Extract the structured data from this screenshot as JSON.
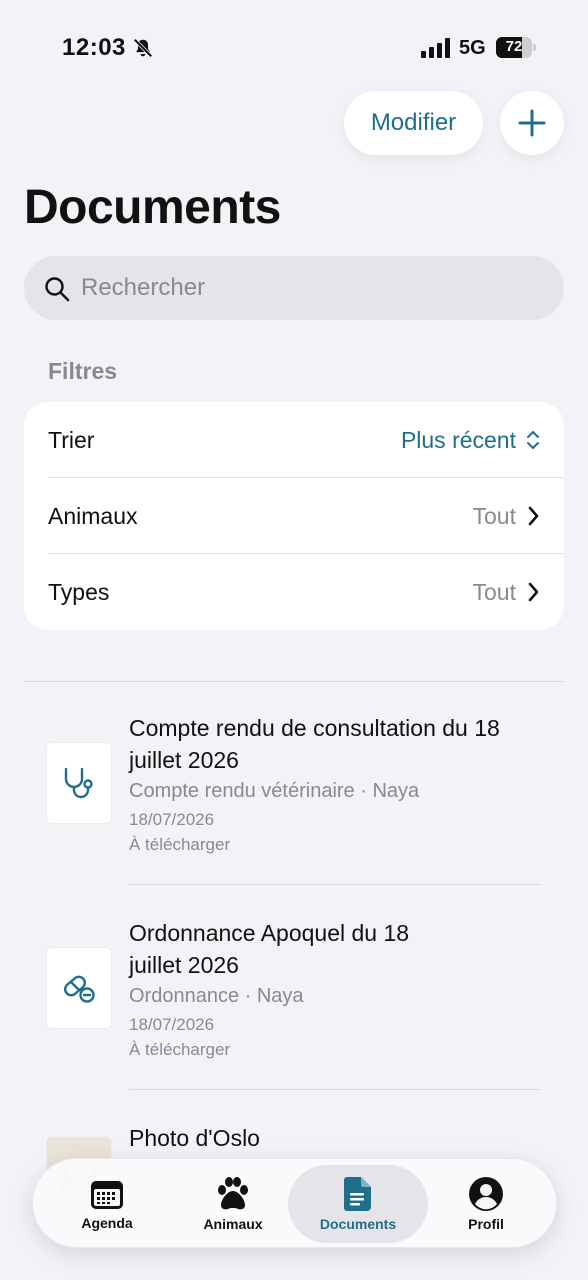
{
  "status_bar": {
    "time": "12:03",
    "network": "5G",
    "battery": "72",
    "battery_level": 0.72
  },
  "header": {
    "edit_label": "Modifier",
    "title": "Documents"
  },
  "search": {
    "placeholder": "Rechercher"
  },
  "filters": {
    "label": "Filtres",
    "rows": [
      {
        "label": "Trier",
        "value": "Plus récent"
      },
      {
        "label": "Animaux",
        "value": "Tout"
      },
      {
        "label": "Types",
        "value": "Tout"
      }
    ]
  },
  "documents": [
    {
      "title": "Compte rendu de consultation du 18 juillet 2026",
      "subtitle": "Compte rendu vétérinaire · Naya",
      "date": "18/07/2026",
      "status": "À télécharger",
      "icon": "stethoscope-icon"
    },
    {
      "title": "Ordonnance Apoquel du 18 juillet 2026",
      "subtitle": "Ordonnance · Naya",
      "date": "18/07/2026",
      "status": "À télécharger",
      "icon": "pill-icon"
    },
    {
      "title": "Photo d'Oslo",
      "icon": "photo-thumbnail"
    }
  ],
  "tab_bar": {
    "tabs": [
      {
        "label": "Agenda",
        "icon": "calendar-icon"
      },
      {
        "label": "Animaux",
        "icon": "paw-icon"
      },
      {
        "label": "Documents",
        "icon": "document-icon",
        "active": true
      },
      {
        "label": "Profil",
        "icon": "profile-icon"
      }
    ]
  },
  "colors": {
    "accent": "#1f6f8b",
    "background": "#f2f2f7",
    "secondary_text": "#8a8a8e"
  }
}
